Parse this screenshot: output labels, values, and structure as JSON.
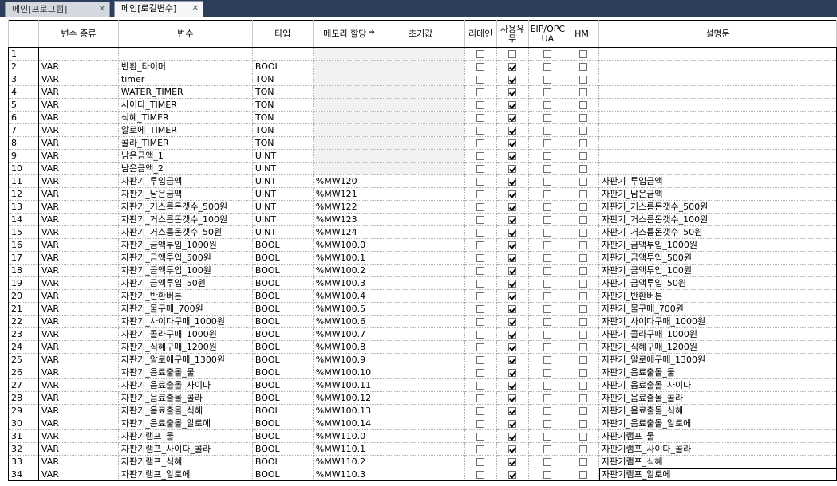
{
  "tabs": [
    {
      "label": "메인[프로그램]",
      "close": "✕"
    },
    {
      "label": "메인[로컬변수]",
      "close": "✕"
    }
  ],
  "columns": {
    "num": "",
    "kind": "변수 종류",
    "var": "변수",
    "type": "타입",
    "mem": "메모리 할당",
    "init": "초기값",
    "retain": "리테인",
    "use": "사용유무",
    "eip": "EIP/OPC UA",
    "hmi": "HMI",
    "desc": "설명문"
  },
  "rows": [
    {
      "n": "1",
      "kind": "",
      "var": "",
      "type": "",
      "mem": "",
      "desc": "",
      "use": false
    },
    {
      "n": "2",
      "kind": "VAR",
      "var": "반환_타이머",
      "type": "BOOL",
      "mem": "",
      "desc": "",
      "use": true
    },
    {
      "n": "3",
      "kind": "VAR",
      "var": "timer",
      "type": "TON",
      "mem": "",
      "desc": "",
      "use": true
    },
    {
      "n": "4",
      "kind": "VAR",
      "var": "WATER_TIMER",
      "type": "TON",
      "mem": "",
      "desc": "",
      "use": true
    },
    {
      "n": "5",
      "kind": "VAR",
      "var": "사이다_TIMER",
      "type": "TON",
      "mem": "",
      "desc": "",
      "use": true
    },
    {
      "n": "6",
      "kind": "VAR",
      "var": "식혜_TIMER",
      "type": "TON",
      "mem": "",
      "desc": "",
      "use": true
    },
    {
      "n": "7",
      "kind": "VAR",
      "var": "알로에_TIMER",
      "type": "TON",
      "mem": "",
      "desc": "",
      "use": true
    },
    {
      "n": "8",
      "kind": "VAR",
      "var": "콜라_TIMER",
      "type": "TON",
      "mem": "",
      "desc": "",
      "use": true
    },
    {
      "n": "9",
      "kind": "VAR",
      "var": "남은금액_1",
      "type": "UINT",
      "mem": "",
      "desc": "",
      "use": true
    },
    {
      "n": "10",
      "kind": "VAR",
      "var": "남은금액_2",
      "type": "UINT",
      "mem": "",
      "desc": "",
      "use": true
    },
    {
      "n": "11",
      "kind": "VAR",
      "var": "자판기_투입금액",
      "type": "UINT",
      "mem": "%MW120",
      "desc": "자판기_투입금액",
      "use": true
    },
    {
      "n": "12",
      "kind": "VAR",
      "var": "자판기_남은금액",
      "type": "UINT",
      "mem": "%MW121",
      "desc": "자판기_남은금액",
      "use": true
    },
    {
      "n": "13",
      "kind": "VAR",
      "var": "자판기_거스름돈갯수_500원",
      "type": "UINT",
      "mem": "%MW122",
      "desc": "자판기_거스름돈갯수_500원",
      "use": true
    },
    {
      "n": "14",
      "kind": "VAR",
      "var": "자판기_거스름돈갯수_100원",
      "type": "UINT",
      "mem": "%MW123",
      "desc": "자판기_거스름돈갯수_100원",
      "use": true
    },
    {
      "n": "15",
      "kind": "VAR",
      "var": "자판기_거스름돈갯수_50원",
      "type": "UINT",
      "mem": "%MW124",
      "desc": "자판기_거스름돈갯수_50원",
      "use": true
    },
    {
      "n": "16",
      "kind": "VAR",
      "var": "자판기_금액투입_1000원",
      "type": "BOOL",
      "mem": "%MW100.0",
      "desc": "자판기_금액투입_1000원",
      "use": true
    },
    {
      "n": "17",
      "kind": "VAR",
      "var": "자판기_금액투입_500원",
      "type": "BOOL",
      "mem": "%MW100.1",
      "desc": "자판기_금액투입_500원",
      "use": true
    },
    {
      "n": "18",
      "kind": "VAR",
      "var": "자판기_금액투입_100원",
      "type": "BOOL",
      "mem": "%MW100.2",
      "desc": "자판기_금액투입_100원",
      "use": true
    },
    {
      "n": "19",
      "kind": "VAR",
      "var": "자판기_금액투입_50원",
      "type": "BOOL",
      "mem": "%MW100.3",
      "desc": "자판기_금액투입_50원",
      "use": true
    },
    {
      "n": "20",
      "kind": "VAR",
      "var": "자판기_반환버튼",
      "type": "BOOL",
      "mem": "%MW100.4",
      "desc": "자판기_반환버튼",
      "use": true
    },
    {
      "n": "21",
      "kind": "VAR",
      "var": "자판기_물구매_700원",
      "type": "BOOL",
      "mem": "%MW100.5",
      "desc": "자판기_물구매_700원",
      "use": true
    },
    {
      "n": "22",
      "kind": "VAR",
      "var": "자판기_사이다구매_1000원",
      "type": "BOOL",
      "mem": "%MW100.6",
      "desc": "자판기_사이다구매_1000원",
      "use": true
    },
    {
      "n": "23",
      "kind": "VAR",
      "var": "자판기_콜라구매_1000원",
      "type": "BOOL",
      "mem": "%MW100.7",
      "desc": "자판기_콜라구매_1000원",
      "use": true
    },
    {
      "n": "24",
      "kind": "VAR",
      "var": "자판기_식혜구매_1200원",
      "type": "BOOL",
      "mem": "%MW100.8",
      "desc": "자판기_식혜구매_1200원",
      "use": true
    },
    {
      "n": "25",
      "kind": "VAR",
      "var": "자판기_알로에구매_1300원",
      "type": "BOOL",
      "mem": "%MW100.9",
      "desc": "자판기_알로에구매_1300원",
      "use": true
    },
    {
      "n": "26",
      "kind": "VAR",
      "var": "자판기_음료출몰_물",
      "type": "BOOL",
      "mem": "%MW100.10",
      "desc": "자판기_음료출몰_물",
      "use": true
    },
    {
      "n": "27",
      "kind": "VAR",
      "var": "자판기_음료출몰_사이다",
      "type": "BOOL",
      "mem": "%MW100.11",
      "desc": "자판기_음료출몰_사이다",
      "use": true
    },
    {
      "n": "28",
      "kind": "VAR",
      "var": "자판기_음료출몰_콜라",
      "type": "BOOL",
      "mem": "%MW100.12",
      "desc": "자판기_음료출몰_콜라",
      "use": true
    },
    {
      "n": "29",
      "kind": "VAR",
      "var": "자판기_음료출몰_식혜",
      "type": "BOOL",
      "mem": "%MW100.13",
      "desc": "자판기_음료출몰_식혜",
      "use": true
    },
    {
      "n": "30",
      "kind": "VAR",
      "var": "자판기_음료출몰_알로에",
      "type": "BOOL",
      "mem": "%MW100.14",
      "desc": "자판기_음료출몰_알로에",
      "use": true
    },
    {
      "n": "31",
      "kind": "VAR",
      "var": "자판기램프_물",
      "type": "BOOL",
      "mem": "%MW110.0",
      "desc": "자판기램프_물",
      "use": true
    },
    {
      "n": "32",
      "kind": "VAR",
      "var": "자판기램프_사이다_콜라",
      "type": "BOOL",
      "mem": "%MW110.1",
      "desc": "자판기램프_사이다_콜라",
      "use": true
    },
    {
      "n": "33",
      "kind": "VAR",
      "var": "자판기램프_식혜",
      "type": "BOOL",
      "mem": "%MW110.2",
      "desc": "자판기램프_식혜",
      "use": true
    },
    {
      "n": "34",
      "kind": "VAR",
      "var": "자판기램프_알로에",
      "type": "BOOL",
      "mem": "%MW110.3",
      "desc": "자판기램프_알로에",
      "use": true
    }
  ]
}
